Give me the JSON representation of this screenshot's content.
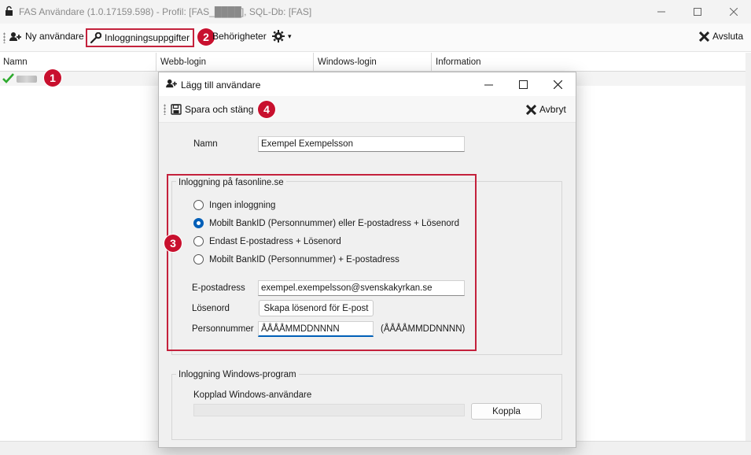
{
  "main_window": {
    "title": "FAS Användare (1.0.17159.598) - Profil: [FAS_████], SQL-Db: [FAS]",
    "toolbar": {
      "new_user": "Ny användare",
      "login_details": "Inloggningsuppgifter",
      "permissions": "Behörigheter",
      "settings_arrow": "▾",
      "exit": "Avsluta"
    },
    "grid": {
      "columns": [
        "Namn",
        "Webb-login",
        "Windows-login",
        "Information"
      ],
      "rows": [
        {
          "status_icon": "checkmark-icon",
          "name": "████"
        }
      ]
    }
  },
  "dialog": {
    "title": "Lägg till användare",
    "toolbar": {
      "save_close": "Spara och stäng",
      "cancel": "Avbryt"
    },
    "name_label": "Namn",
    "name_value": "Exempel Exempelsson",
    "login_group": {
      "title": "Inloggning på fasonline.se",
      "options": [
        {
          "label": "Ingen inloggning",
          "selected": false
        },
        {
          "label": "Mobilt BankID (Personnummer) eller E-postadress + Lösenord",
          "selected": true
        },
        {
          "label": "Endast E-postadress + Lösenord",
          "selected": false
        },
        {
          "label": "Mobilt BankID (Personnummer) + E-postadress",
          "selected": false
        }
      ],
      "email_label": "E-postadress",
      "email_value": "exempel.exempelsson@svenskakyrkan.se",
      "password_label": "Lösenord",
      "password_button": "Skapa lösenord för E-post",
      "personnummer_label": "Personnummer",
      "personnummer_value": "ÅÅÅÅMMDDNNNN",
      "personnummer_hint": "(ÅÅÅÅMMDDNNNN)"
    },
    "windows_group": {
      "title": "Inloggning Windows-program",
      "linked_user_label": "Kopplad Windows-användare",
      "linked_user_value": "",
      "link_button": "Koppla"
    }
  },
  "annotations": {
    "badge_1": "1",
    "badge_2": "2",
    "badge_3": "3",
    "badge_4": "4",
    "color": "#c8102e"
  }
}
